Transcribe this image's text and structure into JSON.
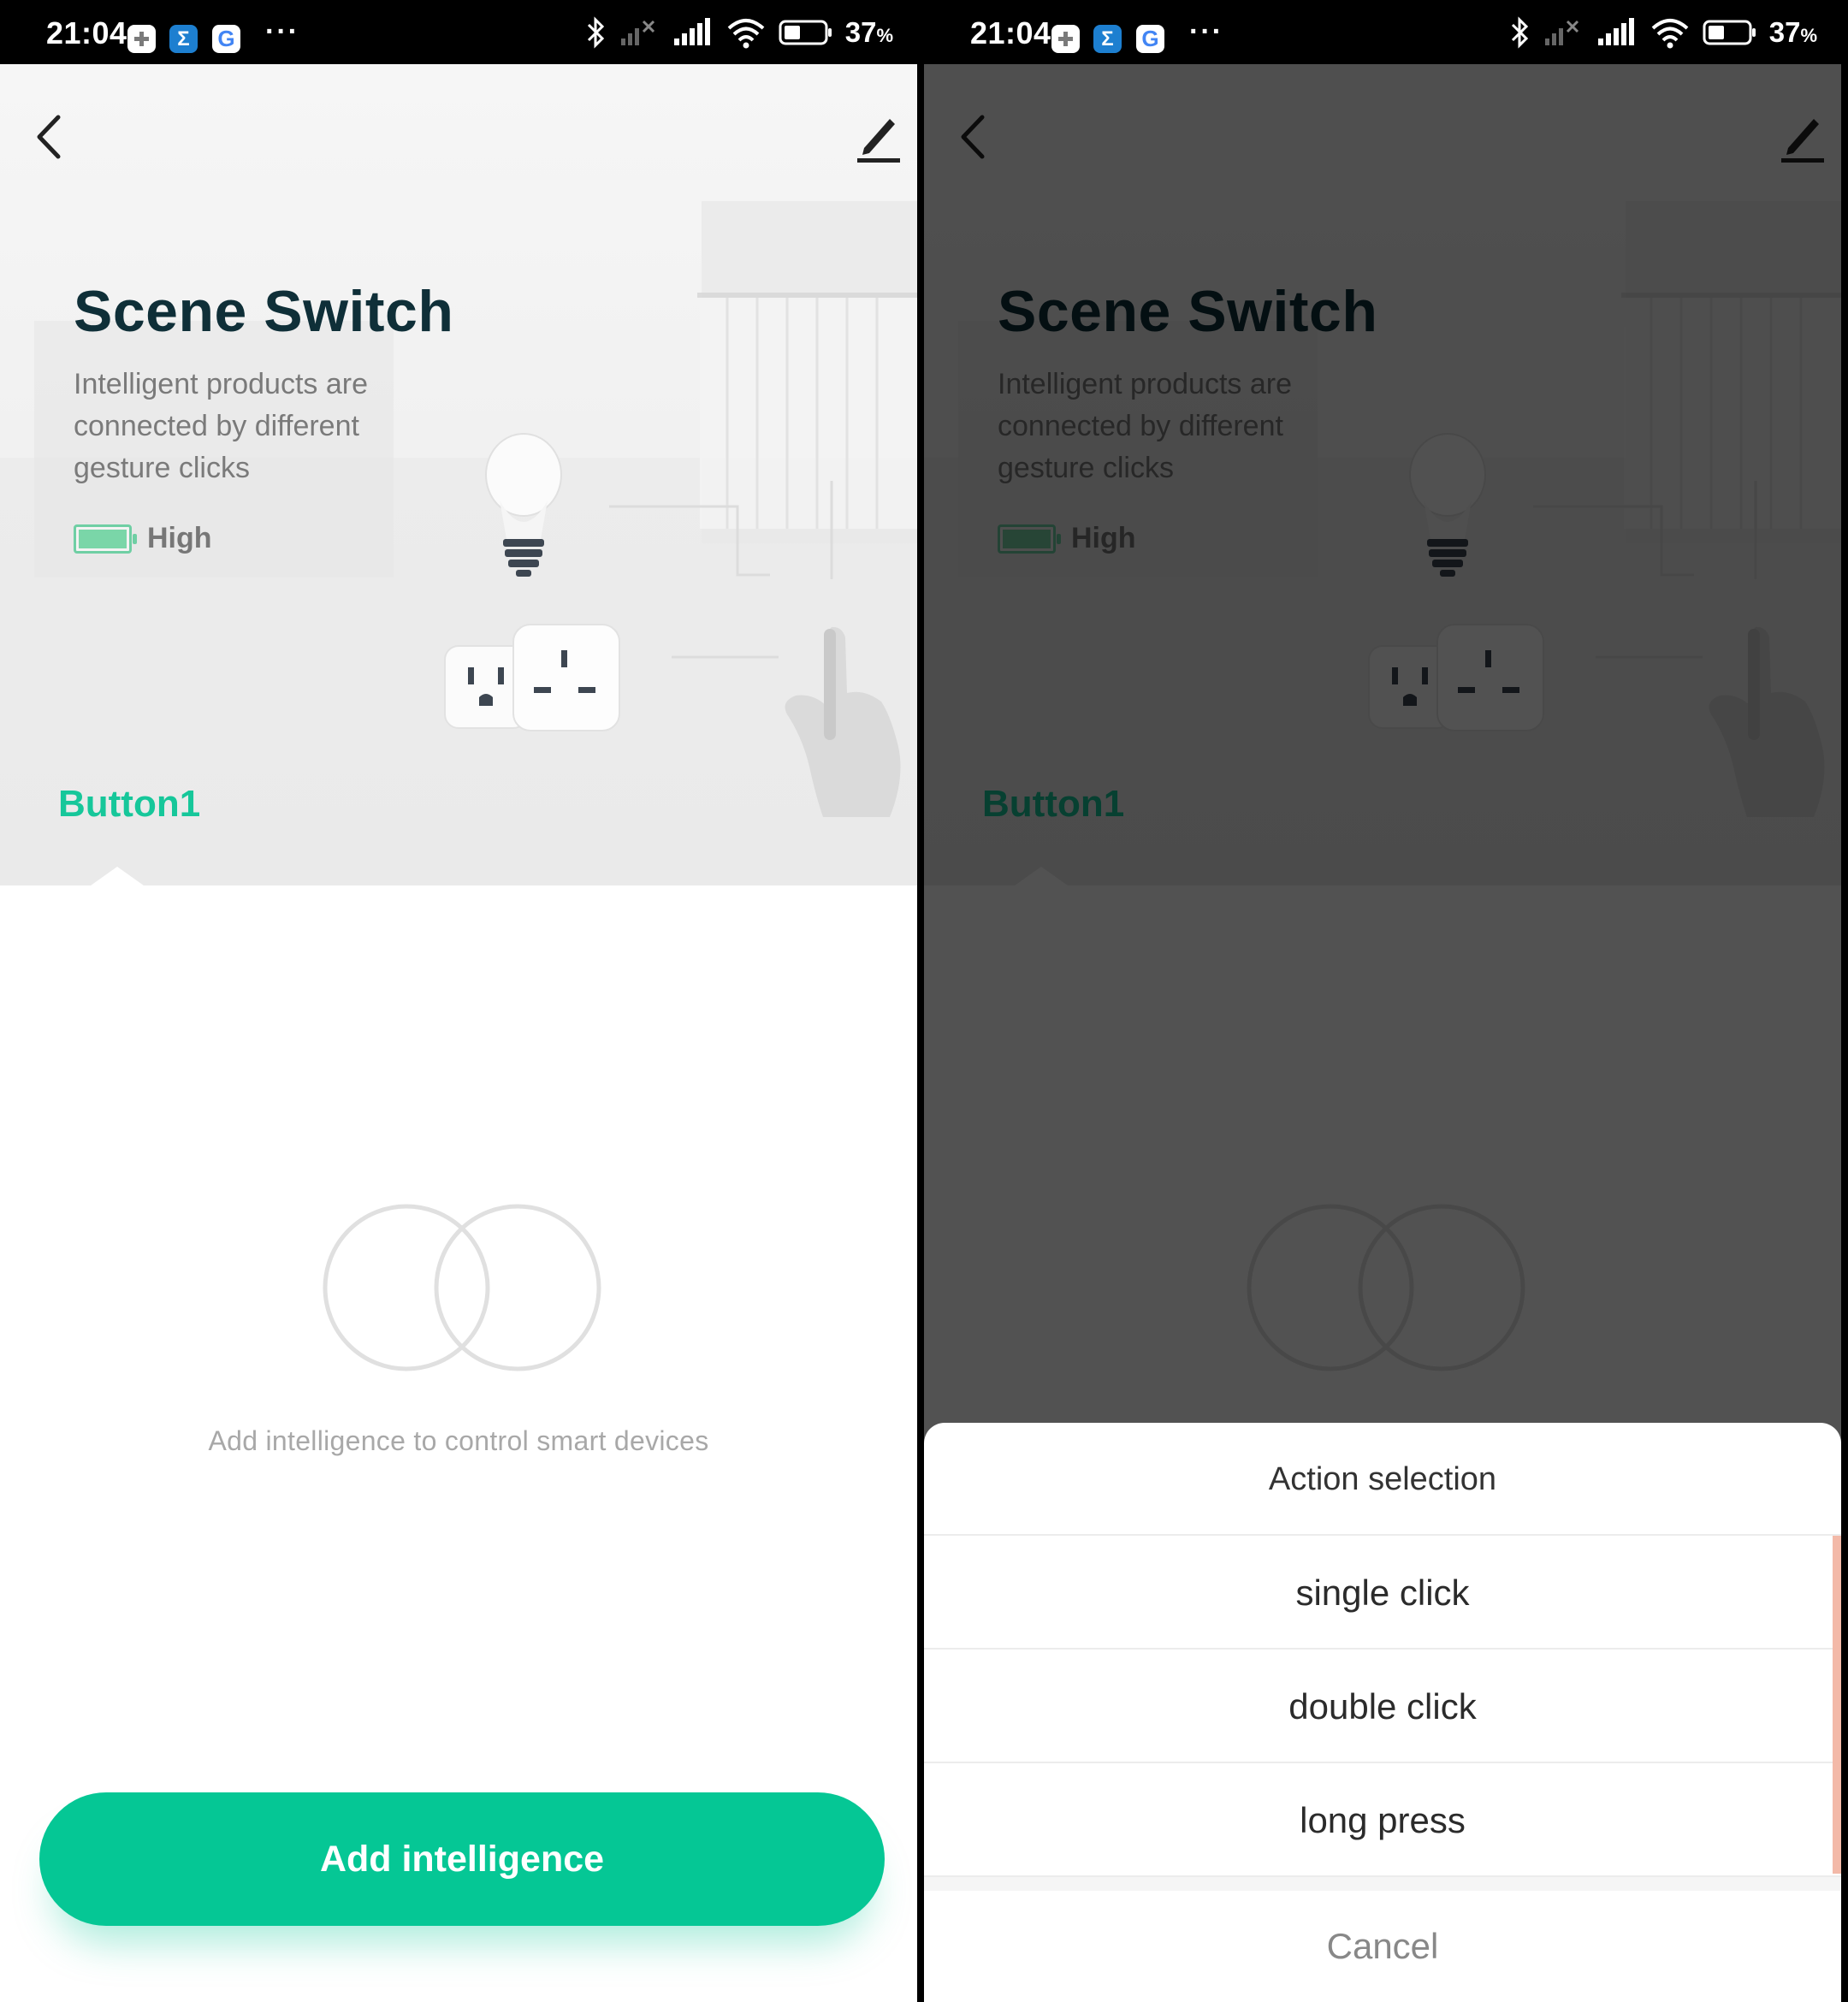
{
  "status_bar": {
    "time": "21:04",
    "battery_pct": "37",
    "battery_unit": "%",
    "more": "···"
  },
  "app": {
    "title": "Scene Switch",
    "subtitle": "Intelligent products are connected by different gesture clicks",
    "battery_label": "High",
    "button_tab": "Button1"
  },
  "empty_state": {
    "text": "Add intelligence to control smart devices"
  },
  "primary_action": {
    "label": "Add intelligence"
  },
  "action_sheet": {
    "title": "Action selection",
    "options": [
      "single click",
      "double click",
      "long press"
    ],
    "cancel": "Cancel"
  },
  "colors": {
    "accent": "#05c795",
    "title": "#0f2f38",
    "battery": "#7ad6a8",
    "overlay": "rgba(0,0,0,0.68)"
  },
  "icons": [
    "back-icon",
    "edit-icon",
    "battery-icon",
    "bluetooth-icon",
    "signal-icon",
    "wifi-icon",
    "bulb-icon",
    "socket-icon",
    "hand-icon",
    "empty-rings-icon"
  ]
}
